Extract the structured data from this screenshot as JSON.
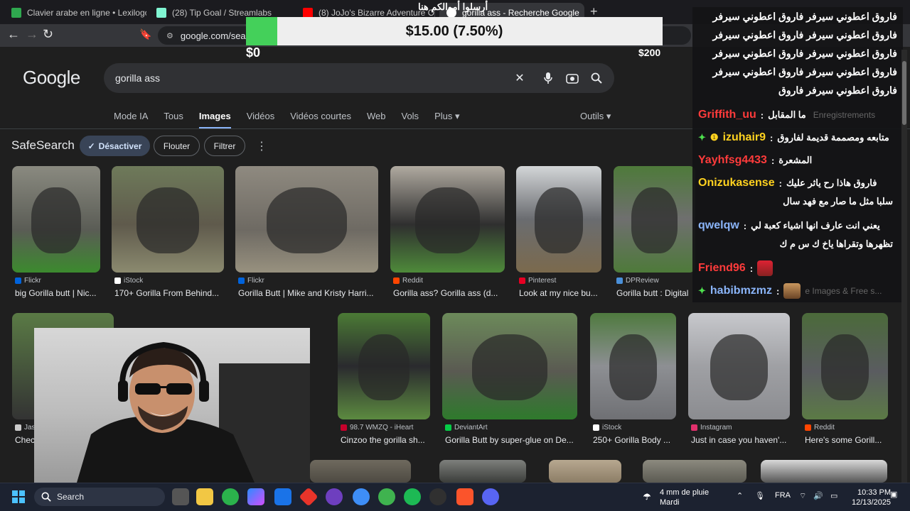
{
  "browser": {
    "tabs": [
      {
        "title": "Clavier arabe en ligne • Lexilogos",
        "favicon_color": "#2fa84f"
      },
      {
        "title": "(28) Tip Goal / Streamlabs",
        "favicon_color": "#80f5d2"
      },
      {
        "title": "(8) JoJo's Bizarre Adventure Openin",
        "favicon_color": "#ff0000"
      },
      {
        "title": "gorilla ass - Recherche Google",
        "favicon_color": "#4285f4"
      }
    ],
    "new_tab": "+",
    "url": "google.com/search"
  },
  "donation_overlay": {
    "title_arabic": "أرسلوا أموالكم هنا",
    "amount_text": "$15.00 (7.50%)",
    "progress_percent": 7.5,
    "min_label": "$0",
    "max_label": "$200",
    "bar_color": "#44d05a"
  },
  "google": {
    "logo": "Google",
    "query": "gorilla ass",
    "tabs": [
      "Mode IA",
      "Tous",
      "Images",
      "Vidéos",
      "Vidéos courtes",
      "Web",
      "Vols",
      "Plus"
    ],
    "active_tab": "Images",
    "tools_label": "Outils",
    "safesearch": {
      "label": "SafeSearch",
      "chips": [
        "Désactiver",
        "Flouter",
        "Filtrer"
      ],
      "active_chip": "Désactiver"
    },
    "results_row1": [
      {
        "source": "Flickr",
        "title": "big Gorilla butt | Nic...",
        "source_color": "#0063dc"
      },
      {
        "source": "iStock",
        "title": "170+ Gorilla From Behind...",
        "source_color": "#ffffff"
      },
      {
        "source": "Flickr",
        "title": "Gorilla Butt | Mike and Kristy Harri...",
        "source_color": "#0063dc"
      },
      {
        "source": "Reddit",
        "title": "Gorilla ass? Gorilla ass (d...",
        "source_color": "#ff4500"
      },
      {
        "source": "Pinterest",
        "title": "Look at my nice bu...",
        "source_color": "#e60023"
      },
      {
        "source": "DPReview",
        "title": "Gorilla butt : Digital",
        "source_color": "#4a90d9"
      }
    ],
    "results_row2": [
      {
        "source": "Jas",
        "title": "Chec",
        "source_color": "#cccccc"
      },
      {
        "source": "98.7 WMZQ - iHeart",
        "title": "Cinzoo the gorilla sh...",
        "source_color": "#c6002b"
      },
      {
        "source": "DeviantArt",
        "title": "Gorilla Butt by super-glue on De...",
        "source_color": "#05cc47"
      },
      {
        "source": "iStock",
        "title": "250+ Gorilla Body ...",
        "source_color": "#ffffff"
      },
      {
        "source": "Instagram",
        "title": "Just in case you haven'...",
        "source_color": "#e1306c"
      },
      {
        "source": "Reddit",
        "title": "Here's some Gorill...",
        "source_color": "#ff4500"
      }
    ]
  },
  "chat": {
    "spam_lines": [
      "فاروق اعطوني سيرفر فاروق اعطوني سيرفر",
      "فاروق اعطوني سيرفر فاروق اعطوني سيرفر",
      "فاروق اعطوني سيرفر فاروق اعطوني سيرفر",
      "فاروق اعطوني سيرفر فاروق اعطوني سيرفر",
      "فاروق اعطوني سيرفر فاروق"
    ],
    "messages": [
      {
        "user": "Griffith_uu",
        "text": "ما المقابل",
        "color": "#ff3b3b"
      },
      {
        "user": "izuhair9",
        "text": "متابعه ومصممة قديمة لفاروق",
        "color": "#ffd21f"
      },
      {
        "user": "Yayhfsg4433",
        "text": "المشعرة",
        "color": "#ff3b3b"
      },
      {
        "user": "Onizukasense",
        "text": "فاروق هاذا رح ياثر عليك",
        "text2": "سلبا مثل ما صار مع فهد سال",
        "color": "#ffd21f"
      },
      {
        "user": "qwelqw",
        "text": "يعني انت عارف انها اشياء كعبة لي",
        "text2": "تظهرها وتقراها ياخ ك س م ك",
        "color": "#8ab4f8"
      },
      {
        "user": "Friend96",
        "text": "",
        "color": "#ff3b3b"
      },
      {
        "user": "habibmzmz",
        "text": "",
        "color": "#8ab4f8"
      }
    ],
    "bg_text": "Enregistrements",
    "bg_text2": "e Images & Free s..."
  },
  "taskbar": {
    "search_label": "Search",
    "weather_line1": "4 mm de pluie",
    "weather_line2": "Mardi",
    "language": "FRA",
    "time": "10:33 PM",
    "date": "12/13/2025"
  }
}
